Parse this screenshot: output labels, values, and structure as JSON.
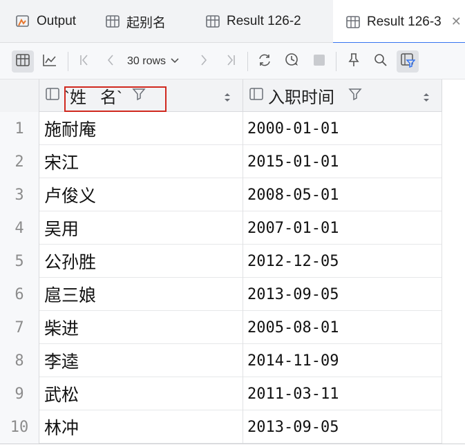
{
  "tabs": [
    {
      "label": "Output",
      "icon": "output-icon",
      "active": false
    },
    {
      "label": "起别名",
      "icon": "table-icon",
      "active": false
    },
    {
      "label": "Result 126-2",
      "icon": "table-icon",
      "active": false
    },
    {
      "label": "Result 126-3",
      "icon": "table-icon",
      "active": true
    }
  ],
  "toolbar": {
    "rows_label": "30 rows",
    "icons": [
      "table-view-icon",
      "chart-view-icon",
      "first-page-icon",
      "prev-page-icon",
      "next-page-icon",
      "last-page-icon",
      "refresh-icon",
      "history-icon",
      "stop-icon",
      "pin-icon",
      "search-icon",
      "filter-toggle-icon"
    ]
  },
  "grid": {
    "columns": [
      {
        "label": "`姓   名`",
        "icon": "column-icon"
      },
      {
        "label": "入职时间",
        "icon": "column-icon"
      }
    ],
    "rows": [
      {
        "num": "1",
        "name": "施耐庵",
        "date": "2000-01-01"
      },
      {
        "num": "2",
        "name": "宋江",
        "date": "2015-01-01"
      },
      {
        "num": "3",
        "name": "卢俊义",
        "date": "2008-05-01"
      },
      {
        "num": "4",
        "name": "吴用",
        "date": "2007-01-01"
      },
      {
        "num": "5",
        "name": "公孙胜",
        "date": "2012-12-05"
      },
      {
        "num": "6",
        "name": "扈三娘",
        "date": "2013-09-05"
      },
      {
        "num": "7",
        "name": "柴进",
        "date": "2005-08-01"
      },
      {
        "num": "8",
        "name": "李逵",
        "date": "2014-11-09"
      },
      {
        "num": "9",
        "name": "武松",
        "date": "2011-03-11"
      },
      {
        "num": "10",
        "name": "林冲",
        "date": "2013-09-05"
      }
    ]
  },
  "colors": {
    "accent": "#3574f0",
    "highlight_border": "#d0281e"
  }
}
